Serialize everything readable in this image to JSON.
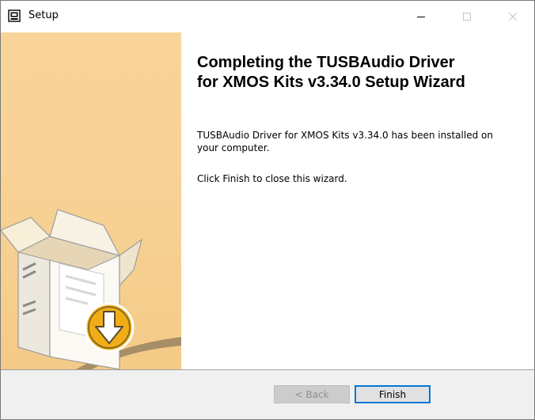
{
  "window": {
    "title": "Setup",
    "controls": {
      "minimize_icon": "minimize-icon",
      "maximize_icon": "maximize-icon",
      "close_icon": "close-icon"
    }
  },
  "content": {
    "heading_line1": "Completing the TUSBAudio Driver",
    "heading_line2": "for XMOS Kits v3.34.0 Setup Wizard",
    "installed_text": "TUSBAudio Driver for XMOS Kits v3.34.0 has been installed on your computer.",
    "instruction_text": "Click Finish to close this wizard."
  },
  "buttons": {
    "back_label": "< Back",
    "back_enabled": false,
    "finish_label": "Finish"
  },
  "colors": {
    "sidebar": "#f7d194",
    "accent": "#0078d7",
    "footer": "#f0f0f0"
  }
}
